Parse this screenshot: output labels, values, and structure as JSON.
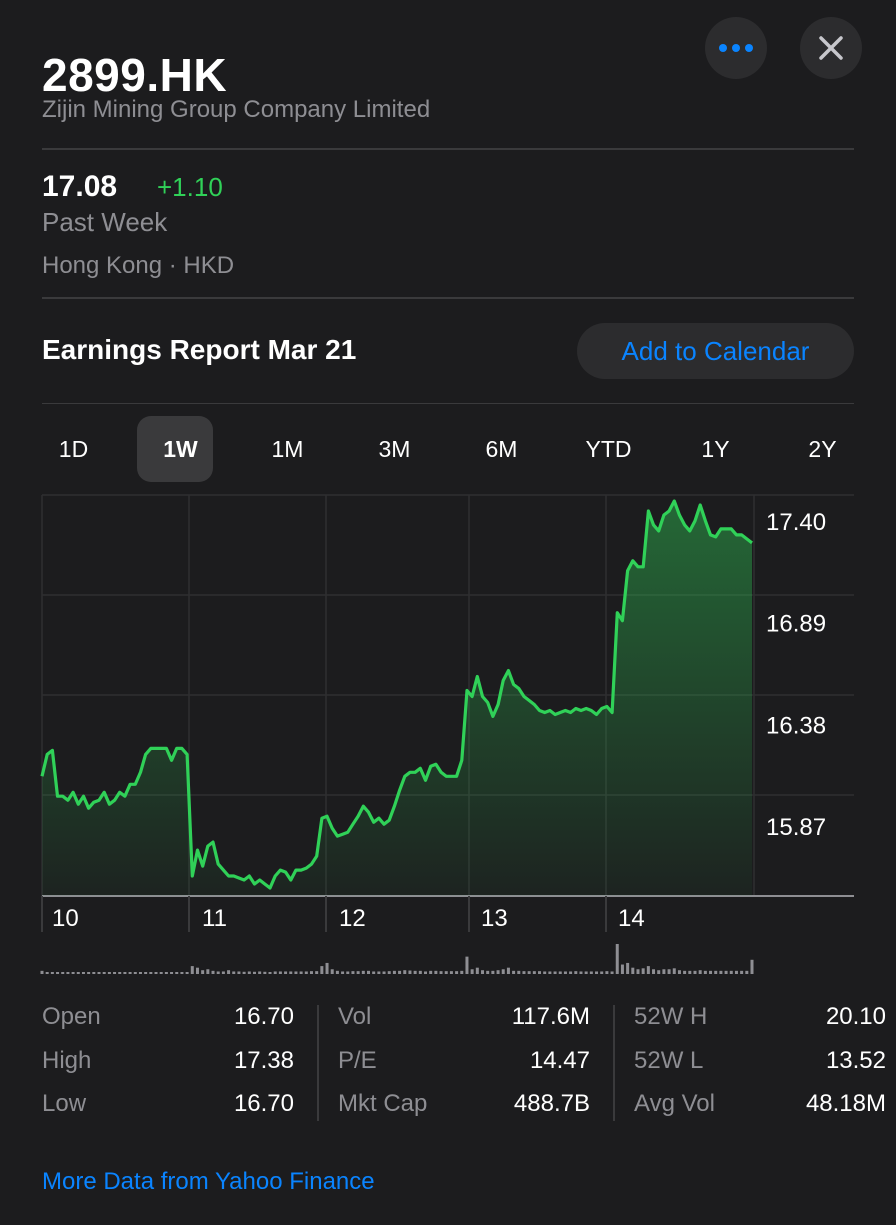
{
  "header": {
    "symbol": "2899.HK",
    "company": "Zijin Mining Group Company Limited",
    "more_icon": "ellipsis-icon",
    "close_icon": "close-icon"
  },
  "quote": {
    "price": "17.08",
    "change": "+1.10",
    "period": "Past Week",
    "exchange": "Hong Kong · HKD"
  },
  "earnings": {
    "label": "Earnings Report Mar 21",
    "button": "Add to Calendar"
  },
  "tabs": [
    {
      "label": "1D",
      "active": false
    },
    {
      "label": "1W",
      "active": true
    },
    {
      "label": "1M",
      "active": false
    },
    {
      "label": "3M",
      "active": false
    },
    {
      "label": "6M",
      "active": false
    },
    {
      "label": "YTD",
      "active": false
    },
    {
      "label": "1Y",
      "active": false
    },
    {
      "label": "2Y",
      "active": false
    }
  ],
  "chart_data": {
    "type": "area",
    "x_labels": [
      "10",
      "11",
      "12",
      "13",
      "14"
    ],
    "y_ticks": [
      "17.40",
      "16.89",
      "16.38",
      "15.87"
    ],
    "ylim": [
      15.52,
      17.53
    ],
    "series": [
      {
        "values": [
          16.12,
          16.23,
          16.25,
          16.02,
          16.02,
          16.0,
          16.04,
          15.98,
          16.02,
          15.96,
          15.99,
          16.0,
          16.04,
          15.98,
          16.0,
          16.04,
          16.02,
          16.08,
          16.08,
          16.14,
          16.23,
          16.26,
          16.26,
          16.26,
          16.26,
          16.2,
          16.26,
          16.26,
          16.23,
          15.62,
          15.75,
          15.67,
          15.77,
          15.79,
          15.68,
          15.65,
          15.62,
          15.62,
          15.61,
          15.6,
          15.62,
          15.58,
          15.6,
          15.58,
          15.56,
          15.62,
          15.65,
          15.64,
          15.6,
          15.65,
          15.65,
          15.66,
          15.68,
          15.72,
          15.91,
          15.92,
          15.86,
          15.82,
          15.83,
          15.84,
          15.88,
          15.92,
          15.97,
          15.94,
          15.89,
          15.91,
          15.88,
          15.9,
          15.97,
          16.05,
          16.12,
          16.14,
          16.14,
          16.16,
          16.1,
          16.17,
          16.18,
          16.14,
          16.12,
          16.12,
          16.12,
          16.2,
          16.55,
          16.52,
          16.62,
          16.52,
          16.49,
          16.42,
          16.48,
          16.6,
          16.65,
          16.58,
          16.56,
          16.52,
          16.5,
          16.48,
          16.45,
          16.44,
          16.45,
          16.43,
          16.44,
          16.45,
          16.44,
          16.46,
          16.45,
          16.46,
          16.45,
          16.43,
          16.46,
          16.47,
          16.44,
          16.94,
          16.9,
          17.15,
          17.2,
          17.17,
          17.17,
          17.45,
          17.38,
          17.35,
          17.43,
          17.45,
          17.5,
          17.43,
          17.38,
          17.35,
          17.4,
          17.48,
          17.4,
          17.33,
          17.32,
          17.36,
          17.36,
          17.36,
          17.33,
          17.33,
          17.31,
          17.29
        ]
      }
    ],
    "volume": [
      1,
      0.6,
      0.4,
      0.3,
      0.6,
      0.5,
      0.4,
      0.4,
      0.5,
      0.4,
      0.4,
      0.5,
      0.4,
      0.4,
      0.5,
      0.4,
      0.4,
      0.5,
      0.4,
      0.5,
      0.6,
      0.5,
      0.4,
      0.5,
      0.4,
      0.4,
      0.5,
      0.4,
      0.4,
      2.5,
      2,
      1.2,
      1.5,
      1,
      0.8,
      0.8,
      1.2,
      0.8,
      0.8,
      0.7,
      0.8,
      0.7,
      0.8,
      0.7,
      0.6,
      0.8,
      0.8,
      0.8,
      0.8,
      0.8,
      0.8,
      0.8,
      0.9,
      0.9,
      2.5,
      3.5,
      1.5,
      1,
      0.8,
      0.8,
      0.9,
      0.9,
      1,
      1,
      0.8,
      0.8,
      0.8,
      0.9,
      1,
      1,
      1.2,
      1.1,
      1,
      1,
      0.8,
      1,
      1,
      0.9,
      0.9,
      0.9,
      0.9,
      1,
      5.5,
      1.5,
      2,
      1.2,
      1,
      1,
      1.2,
      1.5,
      2,
      1,
      1,
      0.9,
      0.9,
      0.9,
      0.9,
      0.8,
      0.8,
      0.8,
      0.8,
      0.8,
      0.8,
      0.9,
      0.8,
      0.8,
      0.8,
      0.8,
      0.8,
      0.9,
      0.8,
      9.5,
      3,
      3.5,
      2,
      1.5,
      1.8,
      2.5,
      1.5,
      1.2,
      1.5,
      1.5,
      1.8,
      1.2,
      1,
      1,
      1,
      1.2,
      1,
      1,
      1,
      1,
      1,
      1,
      1,
      1,
      1,
      4.5
    ]
  },
  "stats": {
    "col1": [
      {
        "label": "Open",
        "value": "16.70"
      },
      {
        "label": "High",
        "value": "17.38"
      },
      {
        "label": "Low",
        "value": "16.70"
      }
    ],
    "col2": [
      {
        "label": "Vol",
        "value": "117.6M"
      },
      {
        "label": "P/E",
        "value": "14.47"
      },
      {
        "label": "Mkt Cap",
        "value": "488.7B"
      }
    ],
    "col3": [
      {
        "label": "52W H",
        "value": "20.10"
      },
      {
        "label": "52W L",
        "value": "13.52"
      },
      {
        "label": "Avg Vol",
        "value": "48.18M"
      }
    ]
  },
  "footer": {
    "link": "More Data from Yahoo Finance"
  },
  "colors": {
    "accent": "#0a84ff",
    "positive": "#30d158",
    "background": "#1c1c1e"
  }
}
